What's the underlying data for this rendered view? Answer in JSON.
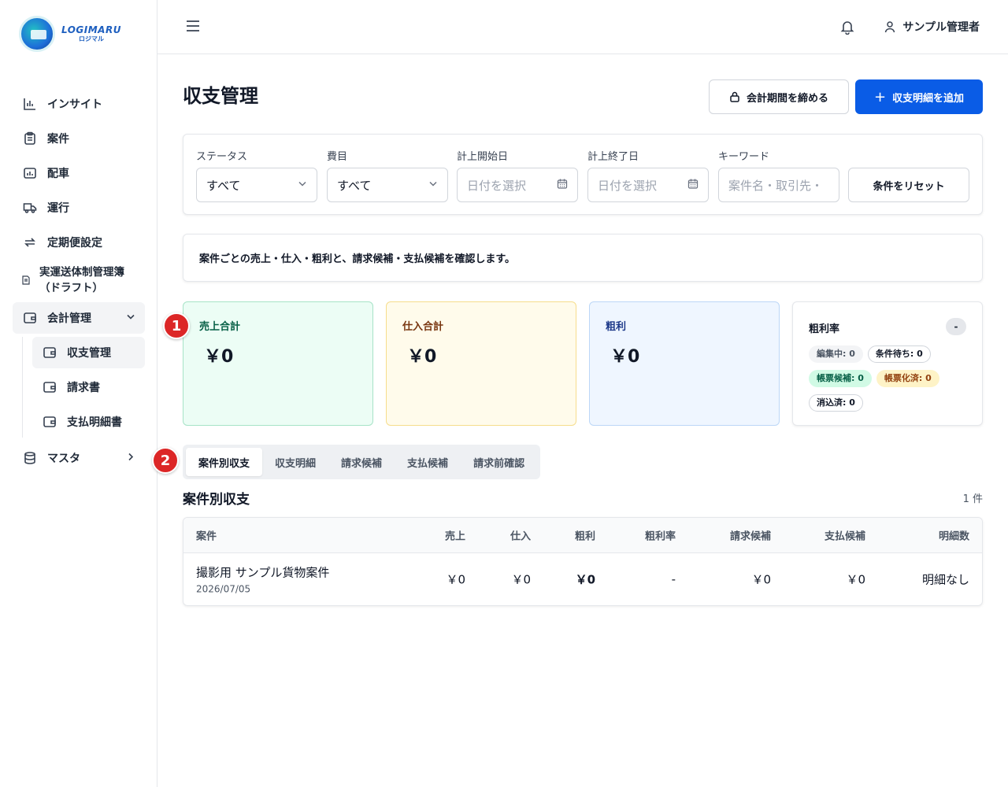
{
  "brand": {
    "name": "LOGIMARU",
    "sub": "ロジマル"
  },
  "sidebar": {
    "items": [
      {
        "label": "インサイト",
        "icon": "bar-chart-icon"
      },
      {
        "label": "案件",
        "icon": "clipboard-icon"
      },
      {
        "label": "配車",
        "icon": "calendar-chart-icon"
      },
      {
        "label": "運行",
        "icon": "truck-icon"
      },
      {
        "label": "定期便設定",
        "icon": "repeat-icon"
      },
      {
        "label": "実運送体制管理簿（ドラフト）",
        "icon": "document-icon"
      },
      {
        "label": "会計管理",
        "icon": "wallet-icon"
      },
      {
        "label": "マスタ",
        "icon": "database-icon"
      }
    ],
    "sub_items": [
      {
        "label": "収支管理",
        "icon": "wallet-icon"
      },
      {
        "label": "請求書",
        "icon": "wallet-icon"
      },
      {
        "label": "支払明細書",
        "icon": "wallet-icon"
      }
    ]
  },
  "header": {
    "user": "サンプル管理者"
  },
  "page": {
    "title": "収支管理",
    "close_period_label": "会計期間を締める",
    "add_label": "収支明細を追加"
  },
  "filters": {
    "status": {
      "label": "ステータス",
      "value": "すべて"
    },
    "cost": {
      "label": "費目",
      "value": "すべて"
    },
    "start": {
      "label": "計上開始日",
      "placeholder": "日付を選択"
    },
    "end": {
      "label": "計上終了日",
      "placeholder": "日付を選択"
    },
    "keyword": {
      "label": "キーワード",
      "placeholder": "案件名・取引先・"
    },
    "reset_label": "条件をリセット"
  },
  "info_text": "案件ごとの売上・仕入・粗利と、請求候補・支払候補を確認します。",
  "summary": {
    "sales": {
      "label": "売上合計",
      "value": "￥0"
    },
    "purchase": {
      "label": "仕入合計",
      "value": "￥0"
    },
    "gross": {
      "label": "粗利",
      "value": "￥0"
    },
    "rate": {
      "label": "粗利率",
      "value": "-",
      "chips": [
        "編集中: 0",
        "条件待ち: 0",
        "帳票候補: 0",
        "帳票化済: 0",
        "消込済: 0"
      ]
    }
  },
  "markers": [
    "1",
    "2"
  ],
  "tabs": [
    "案件別収支",
    "収支明細",
    "請求候補",
    "支払候補",
    "請求前確認"
  ],
  "section": {
    "title": "案件別収支",
    "count": "1 件"
  },
  "table": {
    "columns": [
      "案件",
      "売上",
      "仕入",
      "粗利",
      "粗利率",
      "請求候補",
      "支払候補",
      "明細数"
    ],
    "rows": [
      {
        "name": "撮影用 サンプル貨物案件",
        "date": "2026/07/05",
        "sales": "￥0",
        "purchase": "￥0",
        "gross": "￥0",
        "rate": "-",
        "billing": "￥0",
        "payment": "￥0",
        "details": "明細なし"
      }
    ]
  }
}
